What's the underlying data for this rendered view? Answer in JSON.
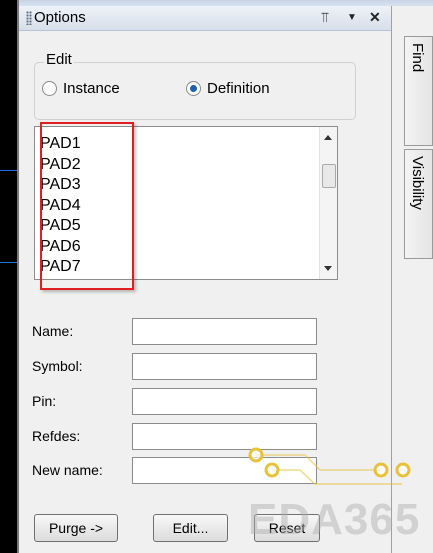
{
  "panel": {
    "title": "Options",
    "pin_glyph": "⫪",
    "menu_glyph": "▼",
    "close_glyph": "✕"
  },
  "edit_group": {
    "label": "Edit",
    "options": [
      {
        "label": "Instance",
        "selected": false
      },
      {
        "label": "Definition",
        "selected": true
      }
    ]
  },
  "list": {
    "items": [
      "PAD1",
      "PAD2",
      "PAD3",
      "PAD4",
      "PAD5",
      "PAD6",
      "PAD7"
    ]
  },
  "form": {
    "fields": [
      {
        "label": "Name:",
        "value": ""
      },
      {
        "label": "Symbol:",
        "value": ""
      },
      {
        "label": "Pin:",
        "value": ""
      },
      {
        "label": "Refdes:",
        "value": ""
      },
      {
        "label": "New name:",
        "value": ""
      }
    ]
  },
  "buttons": {
    "purge": "Purge ->",
    "edit": "Edit...",
    "reset": "Reset"
  },
  "side_tabs": [
    "Find",
    "Visibility"
  ],
  "watermark": "EDA365",
  "colors": {
    "highlight": "#e02020",
    "radio_selected": "#1f5fb0",
    "watermark_dots": "#e8c23a"
  }
}
